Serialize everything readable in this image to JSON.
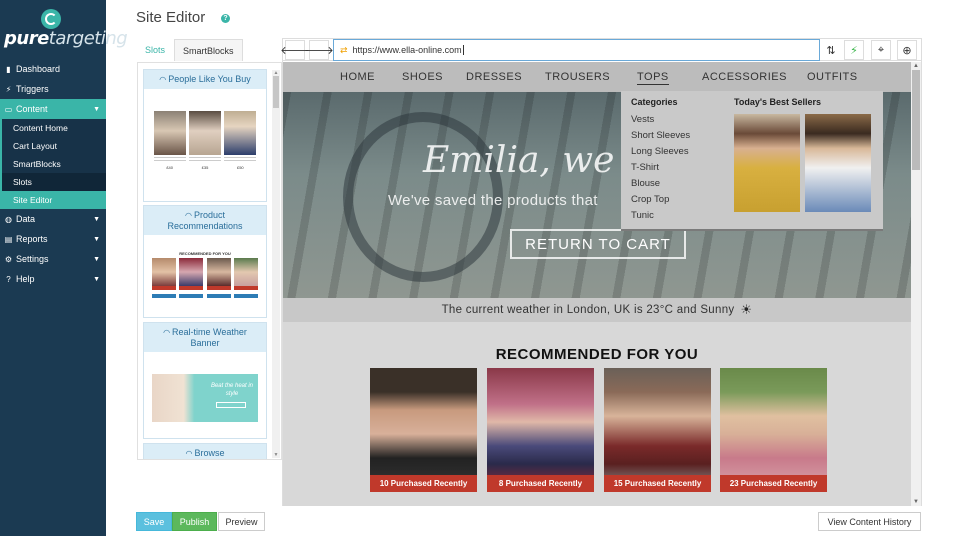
{
  "app": {
    "logo_bold": "pure",
    "logo_light": "targeting"
  },
  "sidebar": {
    "items": [
      {
        "label": "Dashboard",
        "icon": "bookmark-icon"
      },
      {
        "label": "Triggers",
        "icon": "bolt-icon"
      },
      {
        "label": "Content",
        "icon": "content-icon",
        "expanded": true
      },
      {
        "label": "Data",
        "icon": "globe-icon"
      },
      {
        "label": "Reports",
        "icon": "document-icon"
      },
      {
        "label": "Settings",
        "icon": "gear-icon"
      },
      {
        "label": "Help",
        "icon": "question-icon"
      }
    ],
    "content_sub": [
      {
        "label": "Content Home"
      },
      {
        "label": "Cart Layout"
      },
      {
        "label": "SmartBlocks"
      },
      {
        "label": "Slots"
      },
      {
        "label": "Site Editor"
      }
    ]
  },
  "header": {
    "title": "Site Editor"
  },
  "tabs": [
    {
      "label": "Slots"
    },
    {
      "label": "SmartBlocks"
    }
  ],
  "slots": [
    {
      "label": "People Like You Buy"
    },
    {
      "label": "Product Recommendations"
    },
    {
      "label": "Real-time Weather Banner"
    },
    {
      "label": "Browse"
    }
  ],
  "slot_previews": {
    "people_prices": [
      "£40",
      "£35",
      "£50"
    ],
    "rec_title": "RECOMMENDED FOR YOU",
    "weather_text": "Beat the heat in style"
  },
  "browser": {
    "url": "https://www.ella-online.com"
  },
  "site": {
    "nav": [
      "HOME",
      "SHOES",
      "DRESSES",
      "TROUSERS",
      "TOPS",
      "ACCESSORIES",
      "OUTFITS"
    ],
    "active_nav": "TOPS",
    "hero_title": "Emilia, we",
    "hero_sub": "We've saved the products that",
    "hero_button": "RETURN TO CART",
    "weather": "The current weather in London, UK is 23°C and Sunny",
    "rec_title": "RECOMMENDED FOR YOU",
    "rec_items": [
      {
        "label": "10 Purchased Recently"
      },
      {
        "label": "8 Purchased Recently"
      },
      {
        "label": "15 Purchased Recently"
      },
      {
        "label": "23 Purchased Recently"
      }
    ]
  },
  "dropdown": {
    "categories_title": "Categories",
    "categories": [
      "Vests",
      "Short Sleeves",
      "Long Sleeves",
      "T-Shirt",
      "Blouse",
      "Crop Top",
      "Tunic"
    ],
    "bestsellers_title": "Today's Best Sellers"
  },
  "actions": {
    "save": "Save",
    "publish": "Publish",
    "preview": "Preview",
    "history": "View Content History"
  },
  "colors": {
    "sidebar_bg": "#1b3a52",
    "accent": "#3ab5a8",
    "badge_red": "#c0392b"
  }
}
